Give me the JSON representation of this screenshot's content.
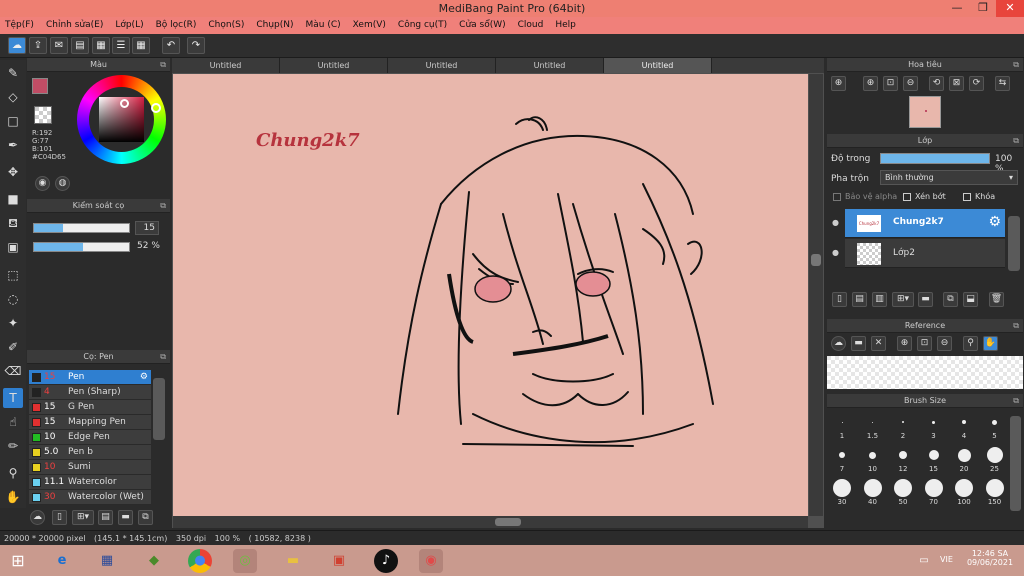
{
  "window": {
    "title": "MediBang Paint Pro (64bit)",
    "minimize": "—",
    "restore": "❐",
    "close": "✕"
  },
  "menu": [
    "Tệp(F)",
    "Chỉnh sửa(E)",
    "Lớp(L)",
    "Bộ lọc(R)",
    "Chọn(S)",
    "Chụp(N)",
    "Màu (C)",
    "Xem(V)",
    "Công cụ(T)",
    "Cửa sổ(W)",
    "Cloud",
    "Help"
  ],
  "doc_tabs": [
    "Untitled",
    "Untitled",
    "Untitled",
    "Untitled",
    "Untitled"
  ],
  "color_panel": {
    "title": "Màu",
    "r": "R:192",
    "g": "G:77",
    "b": "B:101",
    "hex": "#C04D65",
    "fg": "#c04d65"
  },
  "brush_control": {
    "title": "Kiểm soát cọ",
    "size": "15",
    "opacity": "52 %",
    "size_fill": 0.3,
    "opacity_fill": 0.52
  },
  "brush_panel": {
    "title": "Cọ: Pen",
    "items": [
      {
        "size": "15",
        "name": "Pen",
        "color": "#222222",
        "sizecolor": "#ee4040"
      },
      {
        "size": "4",
        "name": "Pen (Sharp)",
        "color": "#222222",
        "sizecolor": "#ee4040"
      },
      {
        "size": "15",
        "name": "G Pen",
        "color": "#e03030",
        "sizecolor": "#ffffff"
      },
      {
        "size": "15",
        "name": "Mapping Pen",
        "color": "#e03030",
        "sizecolor": "#ffffff"
      },
      {
        "size": "10",
        "name": "Edge Pen",
        "color": "#22bb22",
        "sizecolor": "#ffffff"
      },
      {
        "size": "5.0",
        "name": "Pen b",
        "color": "#e8d020",
        "sizecolor": "#ffffff"
      },
      {
        "size": "10",
        "name": "Sumi",
        "color": "#e8d020",
        "sizecolor": "#ee4040"
      },
      {
        "size": "11.1",
        "name": "Watercolor",
        "color": "#6ad0f0",
        "sizecolor": "#ffffff"
      },
      {
        "size": "30",
        "name": "Watercolor (Wet)",
        "color": "#6ad0f0",
        "sizecolor": "#ee4040"
      }
    ]
  },
  "navigator": {
    "title": "Hoa tiêu"
  },
  "layer_panel": {
    "title": "Lớp",
    "opacity_label": "Độ trong",
    "opacity_value": "100 %",
    "blend_label": "Pha trộn",
    "blend_value": "Bình thường",
    "protect_alpha": "Bảo vệ alpha",
    "clipping": "Xén bớt",
    "lock": "Khóa",
    "layers": [
      {
        "name": "Chung2k7",
        "thumb": "Chung2k7"
      },
      {
        "name": "Lớp2",
        "thumb": ""
      }
    ]
  },
  "reference_panel": {
    "title": "Reference"
  },
  "brush_size_panel": {
    "title": "Brush Size",
    "sizes": [
      "1",
      "1.5",
      "2",
      "3",
      "4",
      "5",
      "7",
      "10",
      "12",
      "15",
      "20",
      "25",
      "30",
      "40",
      "50",
      "70",
      "100",
      "150"
    ]
  },
  "canvas_text": "Chung2k7",
  "statusbar": {
    "dims": "20000 * 20000 pixel",
    "cm": "(145.1 * 145.1cm)",
    "dpi": "350 dpi",
    "zoom": "100 %",
    "coords": "( 10582, 8238 )"
  },
  "taskbar": {
    "lang": "VIE",
    "time": "12:46 SA",
    "date": "09/06/2021"
  },
  "icons": {
    "menu_icon_color": "#222222"
  }
}
